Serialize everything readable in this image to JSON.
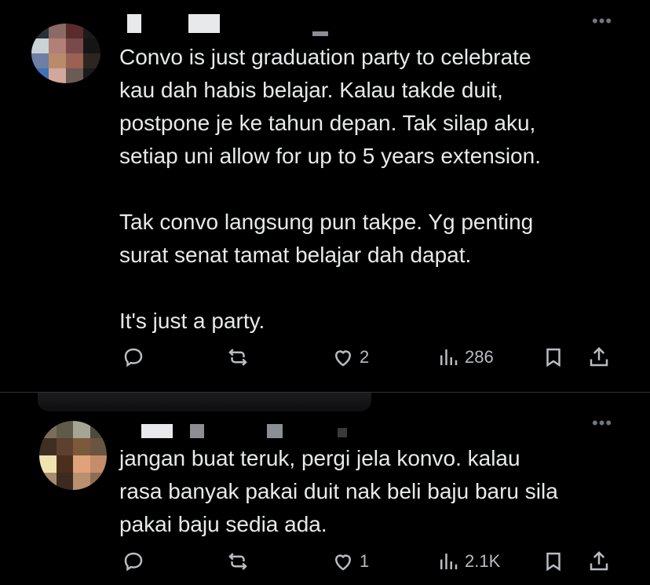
{
  "tweets": [
    {
      "text": "Convo is just graduation party to celebrate\nkau dah habis belajar. Kalau takde duit,\npostpone je ke tahun depan. Tak silap aku,\nsetiap uni allow for up to 5 years extension.\n\nTak convo langsung pun takpe. Yg penting\nsurat senat tamat belajar dah dapat.\n\nIt's just a party.",
      "replies": "",
      "retweets": "",
      "likes": "2",
      "views": "286",
      "more_label": "•••",
      "avatar_colors": [
        "#2b2f36",
        "#8a6a64",
        "#5a2b2b",
        "#1b1b1b",
        "#c9d2d7",
        "#b37f79",
        "#7a4a4a",
        "#151515",
        "#6e7ea5",
        "#b98b6a",
        "#9b6154",
        "#2d2520",
        "#3f73b8",
        "#d2a89a",
        "#6c5a54",
        "#1b1a1b"
      ]
    },
    {
      "text": "jangan buat teruk, pergi jela konvo. kalau\nrasa banyak pakai duit nak beli baju baru sila\npakai baju sedia ada.",
      "replies": "",
      "retweets": "",
      "likes": "1",
      "views": "2.1K",
      "more_label": "•••",
      "avatar_colors": [
        "#7a6e59",
        "#5f5b48",
        "#a6a493",
        "#4b4a3d",
        "#3e2f22",
        "#5d4030",
        "#7b5a3b",
        "#6a5540",
        "#f0e3b0",
        "#4a2e1e",
        "#e0a27a",
        "#c48c6a",
        "#a98b6d",
        "#3b2a20",
        "#b98f6e",
        "#8d6c52"
      ]
    }
  ]
}
